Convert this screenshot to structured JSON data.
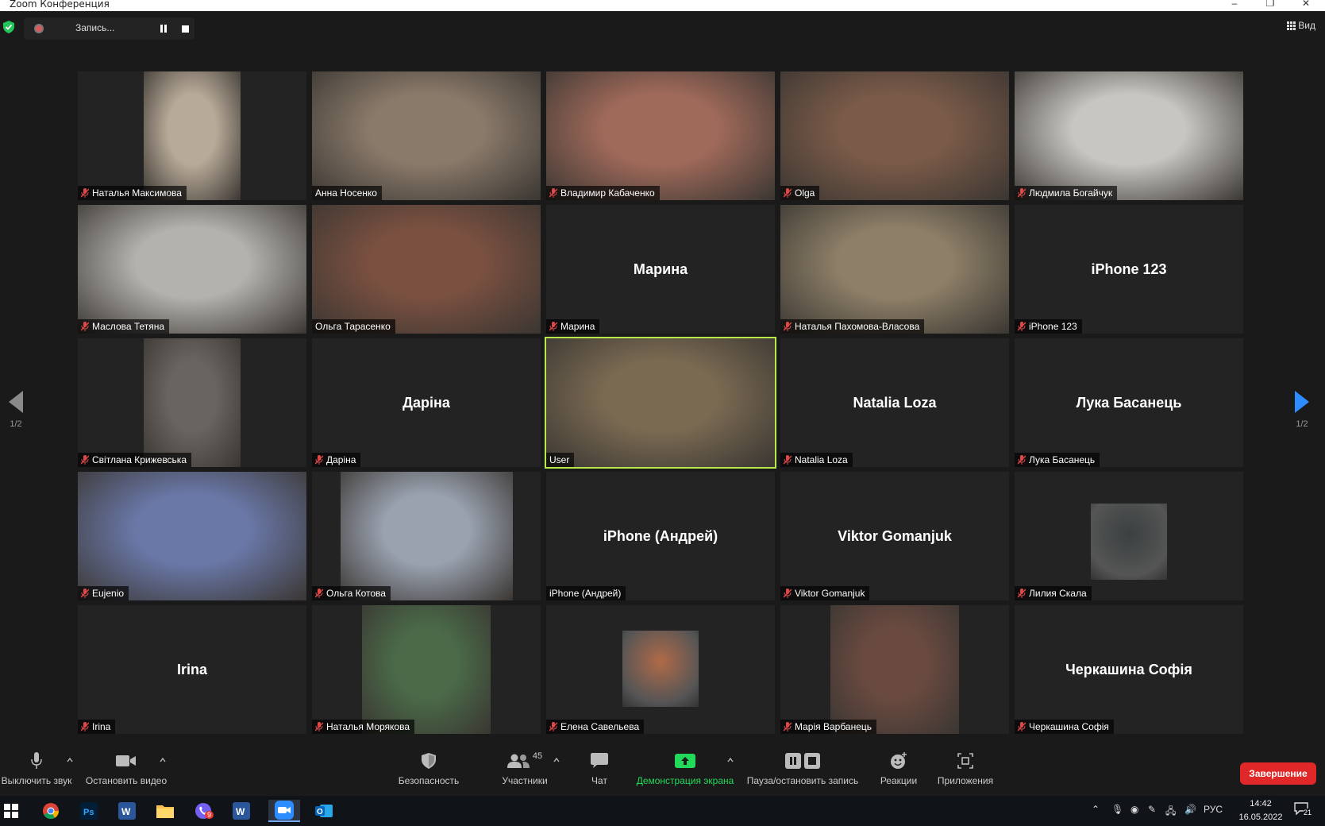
{
  "window": {
    "title": "Zoom Конференция",
    "controls": [
      "minimize",
      "restore",
      "close"
    ]
  },
  "topbar": {
    "record_status": "Запись...",
    "view_label": "Вид"
  },
  "pager": {
    "left_page": "1/2",
    "right_page": "1/2"
  },
  "tiles": [
    {
      "name": "Наталья Максимова",
      "type": "video",
      "muted": true,
      "color": "#b8aa98"
    },
    {
      "name": "Анна Носенко",
      "type": "video",
      "muted": false,
      "color": "#8a7a6a"
    },
    {
      "name": "Владимир Кабаченко",
      "type": "video",
      "muted": true,
      "color": "#a06a5a"
    },
    {
      "name": "Olga",
      "type": "video",
      "muted": true,
      "color": "#7a5a48"
    },
    {
      "name": "Людмила Богайчук",
      "type": "video",
      "muted": true,
      "color": "#c8c6c0"
    },
    {
      "name": "Маслова Тетяна",
      "type": "video",
      "muted": true,
      "color": "#b4b2ac"
    },
    {
      "name": "Ольга Тарасенко",
      "type": "video",
      "muted": false,
      "color": "#7a5040"
    },
    {
      "name": "Марина",
      "type": "name",
      "muted": true,
      "big_label": "Марина"
    },
    {
      "name": "Наталья Пахомова-Власова",
      "type": "video",
      "muted": true,
      "color": "#8e8068"
    },
    {
      "name": "iPhone 123",
      "type": "name",
      "muted": true,
      "big_label": "iPhone 123"
    },
    {
      "name": "Світлана Крижевська",
      "type": "video",
      "muted": true,
      "color": "#6a6460"
    },
    {
      "name": "Даріна",
      "type": "name",
      "muted": true,
      "big_label": "Даріна"
    },
    {
      "name": "User",
      "type": "video",
      "muted": false,
      "active": true,
      "color": "#7a6a52"
    },
    {
      "name": "Natalia Loza",
      "type": "name",
      "muted": true,
      "big_label": "Natalia Loza"
    },
    {
      "name": "Лука Басанець",
      "type": "name",
      "muted": true,
      "big_label": "Лука Басанець"
    },
    {
      "name": "Eujenio",
      "type": "video",
      "muted": true,
      "color": "#6a78a8"
    },
    {
      "name": "Ольга Котова",
      "type": "video",
      "muted": true,
      "color": "#9aa2b0"
    },
    {
      "name": "iPhone (Андрей)",
      "type": "name",
      "muted": false,
      "big_label": "iPhone (Андрей)"
    },
    {
      "name": "Viktor Gomanjuk",
      "type": "name",
      "muted": true,
      "big_label": "Viktor Gomanjuk"
    },
    {
      "name": "Лилия Скала",
      "type": "thumb",
      "muted": true,
      "color": "#3a4040"
    },
    {
      "name": "Irina",
      "type": "name",
      "muted": true,
      "big_label": "Irina"
    },
    {
      "name": "Наталья Морякова",
      "type": "video",
      "muted": true,
      "color": "#4a6a48"
    },
    {
      "name": "Елена Савельева",
      "type": "thumb",
      "muted": true,
      "color": "#b06a48"
    },
    {
      "name": "Марія Варбанець",
      "type": "video",
      "muted": true,
      "color": "#6a4a40"
    },
    {
      "name": "Черкашина Софія",
      "type": "name",
      "muted": true,
      "big_label": "Черкашина Софія"
    }
  ],
  "toolbar": {
    "mute_label": "Выключить звук",
    "video_label": "Остановить видео",
    "security_label": "Безопасность",
    "participants_label": "Участники",
    "participants_count": "45",
    "chat_label": "Чат",
    "share_label": "Демонстрация экрана",
    "record_label": "Пауза/остановить запись",
    "reactions_label": "Реакции",
    "apps_label": "Приложения",
    "end_label": "Завершение",
    "share_color": "#23d959",
    "end_color": "#e02828"
  },
  "taskbar": {
    "apps": [
      "windows-start",
      "chrome",
      "photoshop",
      "word",
      "file-explorer",
      "viber",
      "word",
      "zoom",
      "outlook"
    ],
    "viber_badge": "9",
    "language": "РУС",
    "time": "14:42",
    "date": "16.05.2022",
    "notifications": "21"
  }
}
